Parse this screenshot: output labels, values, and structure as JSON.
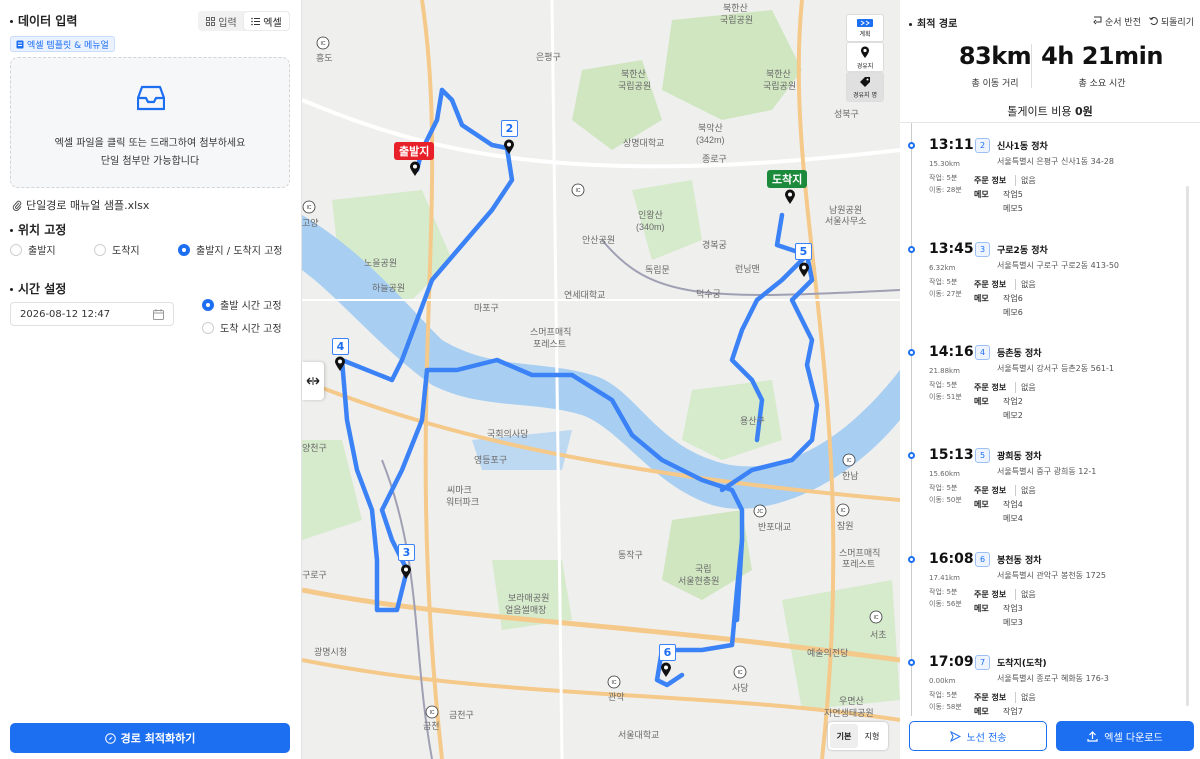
{
  "left": {
    "title": "데이터 입력",
    "mode_input": "입력",
    "mode_excel": "엑셀",
    "template_link": "엑셀 템플릿 & 메뉴얼",
    "drop_line1": "엑셀 파일을 클릭 또는 드래그하여 첨부하세요",
    "drop_line2": "단일 첨부만 가능합니다",
    "file_name": "단일경로 매뉴얼 샘플.xlsx",
    "position_title": "위치 고정",
    "pos_start": "출발지",
    "pos_end": "도착지",
    "pos_both": "출발지 / 도착지 고정",
    "time_title": "시간 설정",
    "date_value": "2026-08-12 12:47",
    "time_depart": "출발 시간 고정",
    "time_arrive": "도착 시간 고정",
    "optimize": "경로 최적화하기"
  },
  "map": {
    "ctrl_plan": "계획",
    "ctrl_waypoint": "경유지",
    "ctrl_waypoint_name": "경유지 명",
    "map_basic": "기본",
    "map_terrain": "지형",
    "start_label": "출발지",
    "end_label": "도착지",
    "markers": [
      "2",
      "3",
      "4",
      "5",
      "6"
    ],
    "route_color": "#3b82f6",
    "start_color": "#e8202a",
    "end_color": "#1b8a3a",
    "places": [
      "은평구",
      "북한산국립공원",
      "북한산국립공원",
      "상명대학교",
      "북악산(342m)",
      "종로구",
      "성북구",
      "인왕산(340m)",
      "경복궁",
      "안산공원",
      "독립문",
      "연세대학교",
      "덕수궁",
      "런닝맨",
      "남원공원서울사무소",
      "마포구",
      "스머프매직포레스트",
      "노을공원",
      "하늘공원",
      "국회의사당",
      "영등포구",
      "씨마크워터파크",
      "용산구",
      "반포대교",
      "동작구",
      "국립서울현충원",
      "보라매공원얼음썰매장",
      "광명시청",
      "예술의전당",
      "서초",
      "우면산자연생태공원",
      "금천구",
      "관악",
      "서울대학교",
      "사당",
      "잠원",
      "한남",
      "양천구",
      "구로구",
      "흥도",
      "고양",
      "국립공원"
    ]
  },
  "right": {
    "title": "최적 경로",
    "reverse": "순서 반전",
    "rollback": "되돌리기",
    "distance": "83km",
    "distance_label": "총 이동 거리",
    "duration": "4h 21min",
    "duration_label": "총 소요 시간",
    "toll_prefix": "톨게이트 비용",
    "toll_value": "0원",
    "send": "노선 전송",
    "download": "엑셀 다운로드",
    "stops": [
      {
        "time": "13:11",
        "dist": "15.30km",
        "work": "작업: 5분",
        "move": "이동: 28분",
        "num": "2",
        "name": "신사1동 정차",
        "addr": "서울특별시 은평구 신사1동 34-28",
        "order_key": "주문 정보",
        "order_val": "없음",
        "memo_key": "메모",
        "memo1": "작업5",
        "memo2": "메모5"
      },
      {
        "time": "13:45",
        "dist": "6.32km",
        "work": "작업: 5분",
        "move": "이동: 27분",
        "num": "3",
        "name": "구로2동 정차",
        "addr": "서울특별시 구로구 구로2동 413-50",
        "order_key": "주문 정보",
        "order_val": "없음",
        "memo_key": "메모",
        "memo1": "작업6",
        "memo2": "메모6"
      },
      {
        "time": "14:16",
        "dist": "21.88km",
        "work": "작업: 5분",
        "move": "이동: 51분",
        "num": "4",
        "name": "등촌동 정차",
        "addr": "서울특별시 강서구 등촌2동 561-1",
        "order_key": "주문 정보",
        "order_val": "없음",
        "memo_key": "메모",
        "memo1": "작업2",
        "memo2": "메모2"
      },
      {
        "time": "15:13",
        "dist": "15.60km",
        "work": "작업: 5분",
        "move": "이동: 50분",
        "num": "5",
        "name": "광희동 정차",
        "addr": "서울특별시 중구 광희동 12-1",
        "order_key": "주문 정보",
        "order_val": "없음",
        "memo_key": "메모",
        "memo1": "작업4",
        "memo2": "메모4"
      },
      {
        "time": "16:08",
        "dist": "17.41km",
        "work": "작업: 5분",
        "move": "이동: 56분",
        "num": "6",
        "name": "봉천동 정차",
        "addr": "서울특별시 관악구 봉천동 1725",
        "order_key": "주문 정보",
        "order_val": "없음",
        "memo_key": "메모",
        "memo1": "작업3",
        "memo2": "메모3"
      },
      {
        "time": "17:09",
        "dist": "0.00km",
        "work": "작업: 5분",
        "move": "이동: 58분",
        "num": "7",
        "name": "도착지(도착)",
        "addr": "서울특별시 종로구 혜화동 176-3",
        "order_key": "주문 정보",
        "order_val": "없음",
        "memo_key": "메모",
        "memo1": "작업7",
        "memo2": ""
      }
    ]
  }
}
